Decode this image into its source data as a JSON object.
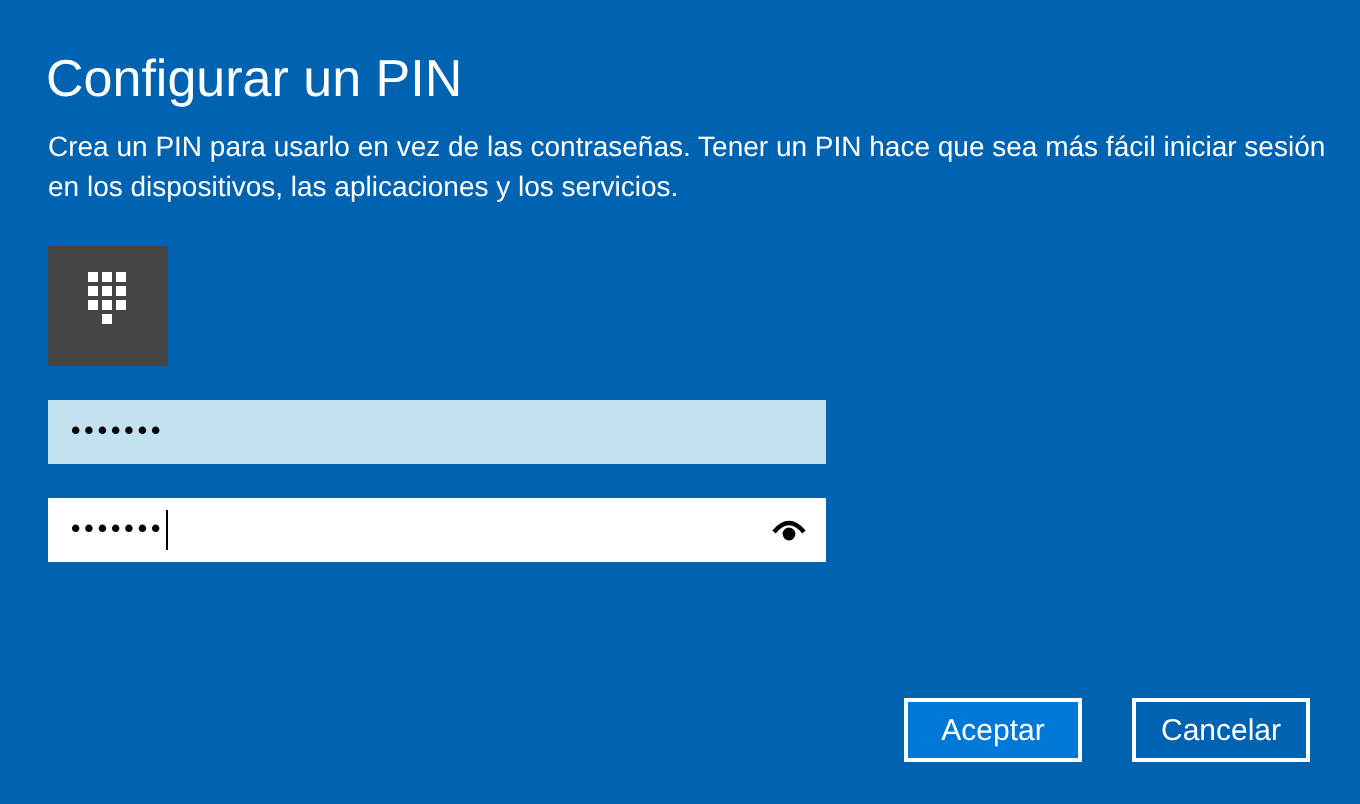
{
  "dialog": {
    "title": "Configurar un PIN",
    "description": "Crea un PIN para usarlo en vez de las contraseñas. Tener un PIN hace que sea más fácil iniciar sesión en los dispositivos, las aplicaciones y los servicios."
  },
  "fields": [
    {
      "value": "•••••••",
      "focused": false
    },
    {
      "value": "•••••••",
      "focused": true
    }
  ],
  "buttons": [
    {
      "label": "Aceptar",
      "default": true
    },
    {
      "label": "Cancelar",
      "default": false
    }
  ]
}
